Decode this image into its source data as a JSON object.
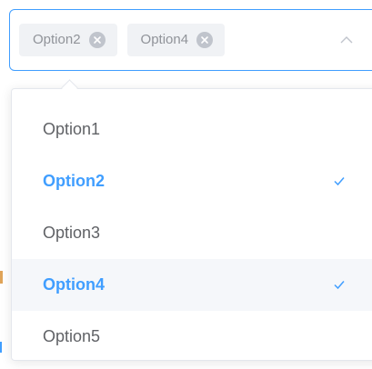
{
  "select": {
    "tags": [
      {
        "label": "Option2",
        "close_icon": "circle-close-icon"
      },
      {
        "label": "Option4",
        "close_icon": "circle-close-icon"
      }
    ],
    "arrow_icon": "chevron-up-icon"
  },
  "dropdown": {
    "options": [
      {
        "label": "Option1",
        "selected": false
      },
      {
        "label": "Option2",
        "selected": true
      },
      {
        "label": "Option3",
        "selected": false
      },
      {
        "label": "Option4",
        "selected": true,
        "hovered": true
      },
      {
        "label": "Option5",
        "selected": false
      }
    ],
    "check_icon": "check-icon"
  },
  "colors": {
    "accent": "#409eff",
    "border": "#dcdfe6",
    "tag_bg": "#f0f2f5",
    "tag_text": "#909399",
    "option_text": "#606266",
    "hover_bg": "#f5f7fa"
  }
}
